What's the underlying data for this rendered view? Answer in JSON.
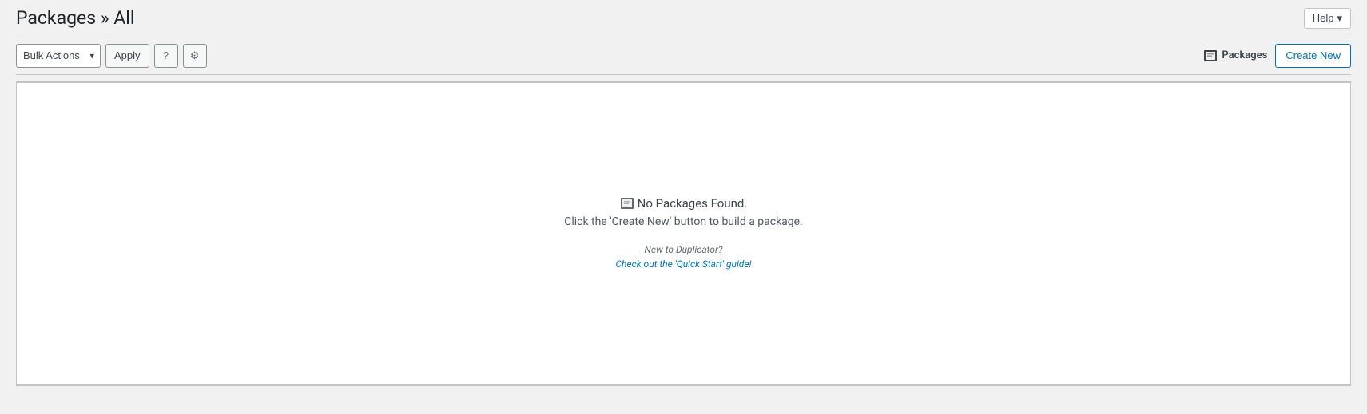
{
  "header": {
    "title": "Packages » All",
    "help_label": "Help"
  },
  "toolbar": {
    "bulk_actions_label": "Bulk Actions",
    "apply_label": "Apply",
    "help_icon": "?",
    "settings_icon": "⚙",
    "packages_link_label": "Packages",
    "create_new_label": "Create New"
  },
  "empty_state": {
    "icon_alt": "packages-icon",
    "title": "No Packages Found.",
    "subtitle": "Click the 'Create New' button to build a package.",
    "new_to_label": "New to Duplicator?",
    "quick_start_label": "Check out the 'Quick Start' guide!"
  }
}
